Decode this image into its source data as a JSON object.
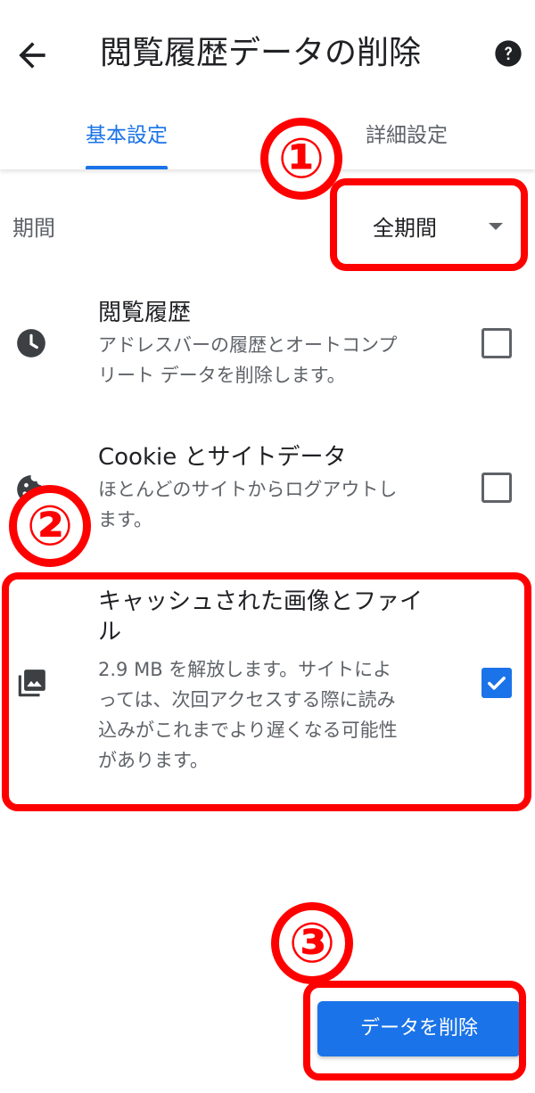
{
  "header": {
    "title": "閲覧履歴データの削除",
    "back_icon": "arrow-back-icon",
    "help_icon": "help-circle-icon"
  },
  "tabs": [
    {
      "label": "基本設定",
      "selected": true
    },
    {
      "label": "詳細設定",
      "selected": false
    }
  ],
  "period": {
    "label": "期間",
    "value": "全期間"
  },
  "items": [
    {
      "title": "閲覧履歴",
      "description": [
        "アドレスバーの履歴とオートコンプ",
        "リート データを削除します。"
      ],
      "icon": "clock-icon",
      "checked": false
    },
    {
      "title": "Cookie とサイトデータ",
      "description": [
        "ほとんどのサイトからログアウトし",
        "ます。"
      ],
      "icon": "cookie-icon",
      "checked": false
    },
    {
      "title": [
        "キャッシュされた画像とファイ",
        "ル"
      ],
      "description": [
        "2.9 MB を解放します。サイトによ",
        "っては、次回アクセスする際に読み",
        "込みがこれまでより遅くなる可能性",
        "があります。"
      ],
      "icon": "image-icon",
      "checked": true
    }
  ],
  "delete_button": {
    "label": "データを削除"
  },
  "annotations": {
    "step1": "①",
    "step2": "②",
    "step3": "③",
    "color": "#ff0000"
  },
  "colors": {
    "accent": "#1a73e8",
    "text_primary": "#202124",
    "text_secondary": "#5f6368"
  }
}
